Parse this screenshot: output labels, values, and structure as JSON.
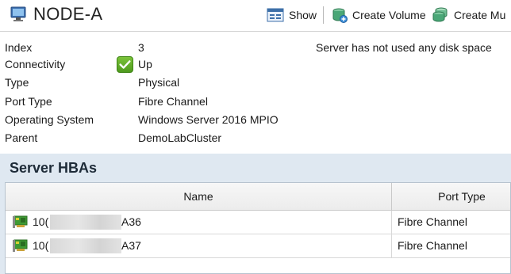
{
  "header": {
    "title": "NODE-A",
    "toolbar": {
      "show_label": "Show",
      "create_volume_label": "Create Volume",
      "create_multi_label": "Create Mu"
    }
  },
  "properties": [
    {
      "label": "Index",
      "value": "3"
    },
    {
      "label": "Connectivity",
      "value": "Up",
      "icon": "check-icon"
    },
    {
      "label": "Type",
      "value": "Physical"
    },
    {
      "label": "Port Type",
      "value": "Fibre Channel"
    },
    {
      "label": "Operating System",
      "value": "Windows Server 2016 MPIO"
    },
    {
      "label": "Parent",
      "value": "DemoLabCluster"
    }
  ],
  "status_note": "Server has not used any disk space",
  "hba_section": {
    "title": "Server HBAs",
    "columns": {
      "name": "Name",
      "port_type": "Port Type"
    },
    "rows": [
      {
        "name_prefix": "10(",
        "name_suffix": "A36",
        "port_type": "Fibre Channel"
      },
      {
        "name_prefix": "10(",
        "name_suffix": "A37",
        "port_type": "Fibre Channel"
      }
    ]
  },
  "colors": {
    "panel_bg": "#dfe8f1",
    "up_green": "#5aa826"
  }
}
